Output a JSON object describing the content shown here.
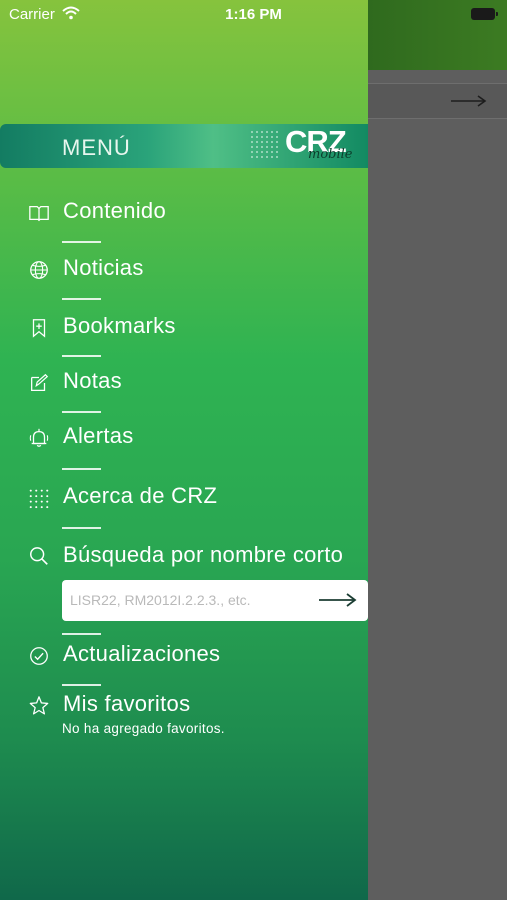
{
  "status_bar": {
    "carrier": "Carrier",
    "time": "1:16 PM"
  },
  "menu": {
    "title": "MENÚ",
    "logo_text": "CRZ",
    "logo_sub": "mobile",
    "items": [
      {
        "label": "Contenido",
        "icon": "book-icon"
      },
      {
        "label": "Noticias",
        "icon": "globe-icon"
      },
      {
        "label": "Bookmarks",
        "icon": "bookmark-icon"
      },
      {
        "label": "Notas",
        "icon": "edit-note-icon"
      },
      {
        "label": "Alertas",
        "icon": "bell-icon"
      },
      {
        "label": "Acerca de CRZ",
        "icon": "dots-grid-icon"
      },
      {
        "label": "Búsqueda por nombre corto",
        "icon": "search-icon"
      },
      {
        "label": "Actualizaciones",
        "icon": "check-circle-icon"
      },
      {
        "label": "Mis favoritos",
        "icon": "star-icon"
      }
    ],
    "search": {
      "placeholder": "LISR22, RM2012I.2.2.3., etc.",
      "value": ""
    },
    "favorites_empty": "No ha agregado favoritos."
  },
  "colors": {
    "accent": "#2fb352",
    "header": "#137c62"
  }
}
